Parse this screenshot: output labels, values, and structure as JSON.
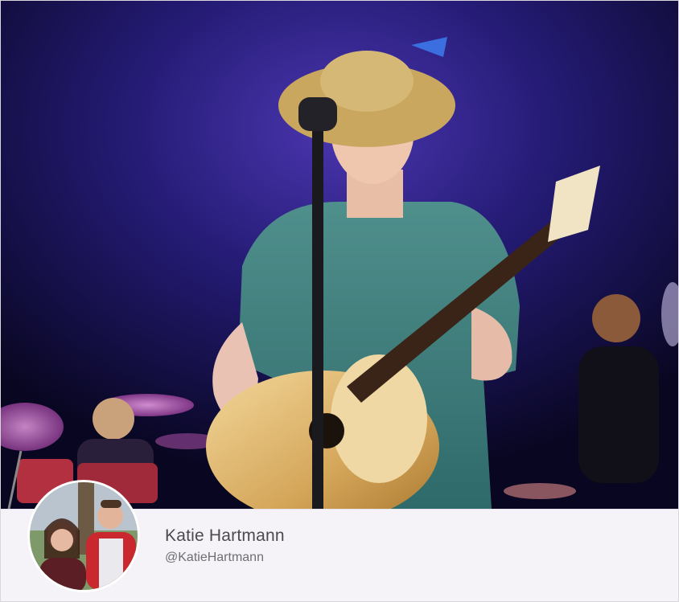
{
  "photo": {
    "subject": "concert-performer-photo"
  },
  "profile": {
    "name": "Katie Hartmann",
    "handle": "@KatieHartmann"
  },
  "colors": {
    "footer_bg": "#f5f3f7",
    "name_text": "#4a4a4f",
    "handle_text": "#6e6e75"
  }
}
